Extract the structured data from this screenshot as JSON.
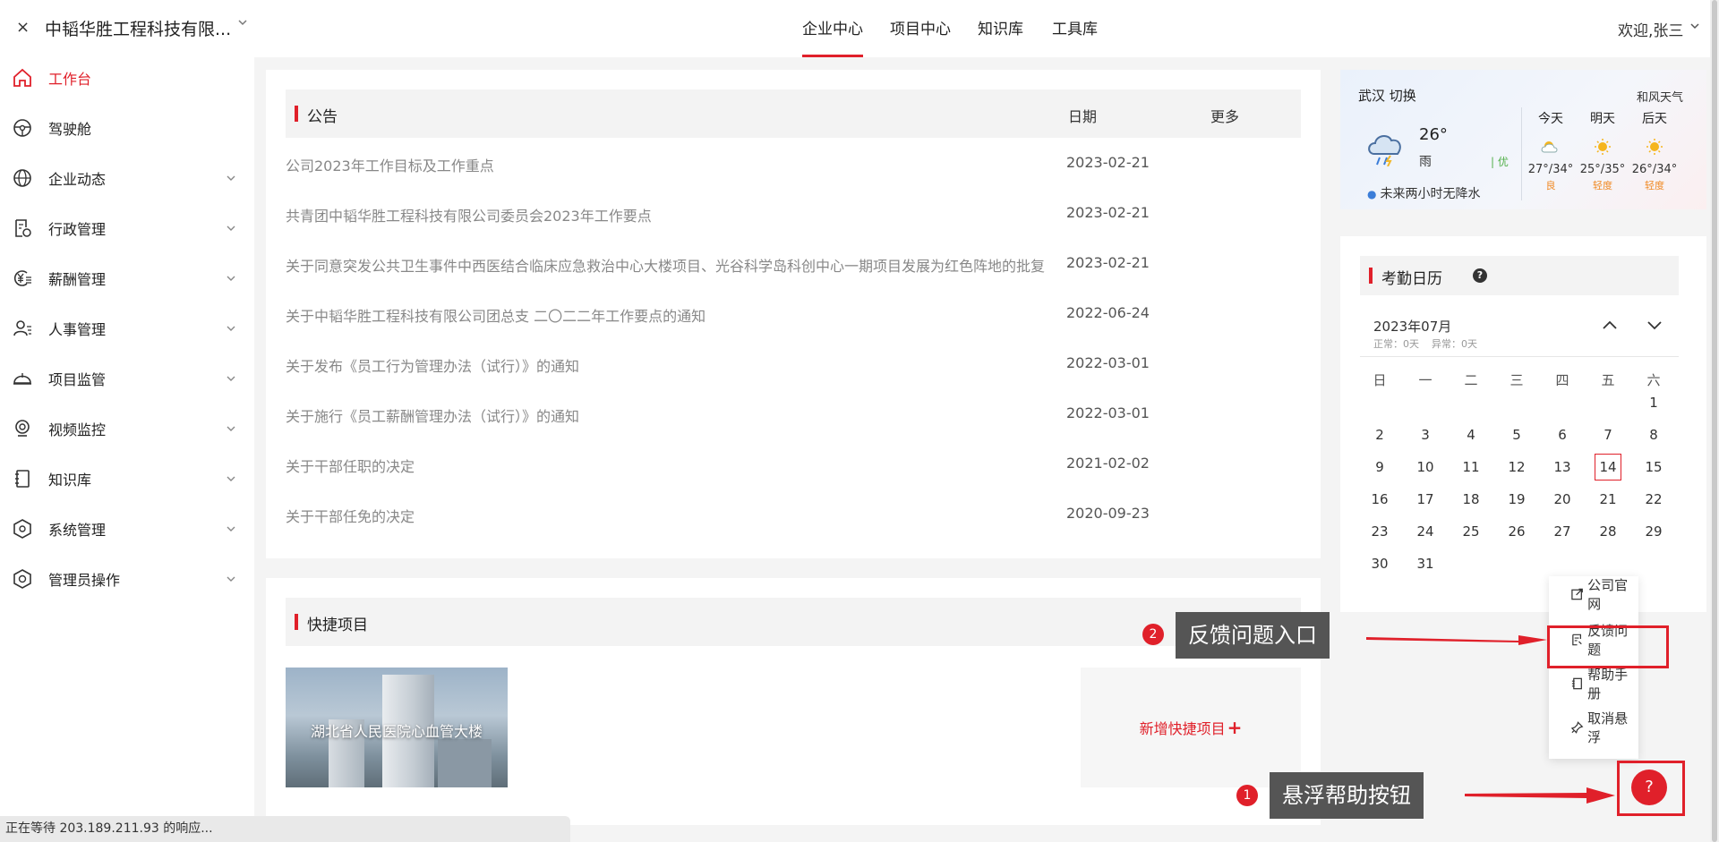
{
  "header": {
    "close": "×",
    "company": "中韬华胜工程科技有限...",
    "nav": [
      "企业中心",
      "项目中心",
      "知识库",
      "工具库"
    ],
    "active_nav": "企业中心",
    "welcome": "欢迎,张三"
  },
  "sidebar": {
    "items": [
      {
        "label": "工作台",
        "icon": "home-icon",
        "active": true
      },
      {
        "label": "驾驶舱",
        "icon": "steering-wheel-icon"
      },
      {
        "label": "企业动态",
        "icon": "globe-icon"
      },
      {
        "label": "行政管理",
        "icon": "document-settings-icon"
      },
      {
        "label": "薪酬管理",
        "icon": "yen-coin-icon"
      },
      {
        "label": "人事管理",
        "icon": "user-list-icon"
      },
      {
        "label": "项目监管",
        "icon": "helmet-icon"
      },
      {
        "label": "视频监控",
        "icon": "camera-icon"
      },
      {
        "label": "知识库",
        "icon": "notebook-icon"
      },
      {
        "label": "系统管理",
        "icon": "hex-settings-icon"
      },
      {
        "label": "管理员操作",
        "icon": "hex-admin-icon"
      }
    ]
  },
  "notice": {
    "title": "公告",
    "date_header": "日期",
    "more": "更多",
    "rows": [
      {
        "title": "公司2023年工作目标及工作重点",
        "date": "2023-02-21"
      },
      {
        "title": "共青团中韬华胜工程科技有限公司委员会2023年工作要点",
        "date": "2023-02-21"
      },
      {
        "title": "关于同意突发公共卫生事件中西医结合临床应急救治中心大楼项目、光谷科学岛科创中心一期项目发展为红色阵地的批复",
        "date": "2023-02-21"
      },
      {
        "title": "关于中韬华胜工程科技有限公司团总支 二〇二二年工作要点的通知",
        "date": "2022-06-24"
      },
      {
        "title": "关于发布《员工行为管理办法（试行）》的通知",
        "date": "2022-03-01"
      },
      {
        "title": "关于施行《员工薪酬管理办法（试行）》的通知",
        "date": "2022-03-01"
      },
      {
        "title": "关于干部任职的决定",
        "date": "2021-02-02"
      },
      {
        "title": "关于干部任免的决定",
        "date": "2020-09-23"
      }
    ]
  },
  "quick": {
    "title": "快捷项目",
    "project": "湖北省人民医院心血管大楼",
    "add_label": "新增快捷项目",
    "add_icon": "+"
  },
  "weather": {
    "city": "武汉 切换",
    "brand": "和风天气",
    "temp": "26°",
    "condition": "雨",
    "aqi": "| 优",
    "rain": "未来两小时无降水",
    "days": [
      {
        "name": "今天",
        "range": "27°/34°",
        "quality": "良",
        "icon": "partly-sunny-icon"
      },
      {
        "name": "明天",
        "range": "25°/35°",
        "quality": "轻度",
        "icon": "sun-icon"
      },
      {
        "name": "后天",
        "range": "26°/34°",
        "quality": "轻度",
        "icon": "sun-icon"
      }
    ]
  },
  "calendar": {
    "title": "考勤日历",
    "help": "?",
    "month": "2023年07月",
    "summary": "正常：0天    异常：0天",
    "weekdays": [
      "日",
      "一",
      "二",
      "三",
      "四",
      "五",
      "六"
    ],
    "days_in_month": 31,
    "first_weekday": 6,
    "today": 14
  },
  "float_menu": {
    "items": [
      "公司官网",
      "反馈问题",
      "帮助手册",
      "取消悬浮"
    ]
  },
  "callouts": [
    {
      "number": "2",
      "text": "反馈问题入口"
    },
    {
      "number": "1",
      "text": "悬浮帮助按钮"
    }
  ],
  "help_button": "?",
  "status_bar": "正在等待 203.189.211.93 的响应...",
  "colors": {
    "accent": "#e0202a"
  }
}
